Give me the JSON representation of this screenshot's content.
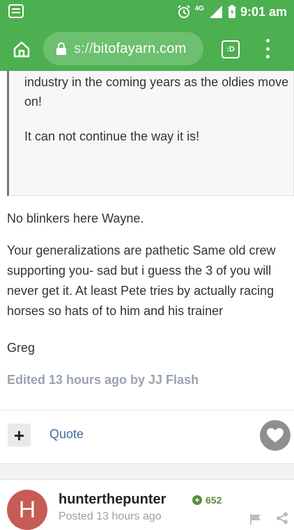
{
  "statusbar": {
    "network": "4G",
    "time": "9:01 am"
  },
  "browser": {
    "url_scheme": "s://",
    "url_host": "bitofayarn.com",
    "tabs_label": ":D"
  },
  "quote": {
    "line1": "industry in the coming years as the oldies move on!",
    "line2": "It can not continue the way it is!"
  },
  "post": {
    "p1": "No blinkers here Wayne.",
    "p2": "Your generalizations are pathetic Same old crew supporting you- sad but i guess the 3 of you will never get it. At least Pete tries by actually racing horses so hats of to him and his trainer",
    "p3": "Greg",
    "edited": "Edited 13 hours ago by JJ Flash"
  },
  "actions": {
    "plus_label": "+",
    "quote_label": "Quote"
  },
  "next_post": {
    "avatar_letter": "H",
    "username": "hunterthepunter",
    "reputation": "652",
    "posted": "Posted 13 hours ago"
  },
  "colors": {
    "browser_green": "#4caf50",
    "link_blue": "#3d6ca0",
    "avatar_red": "#c75b55",
    "rep_green": "#5b8c3a"
  }
}
